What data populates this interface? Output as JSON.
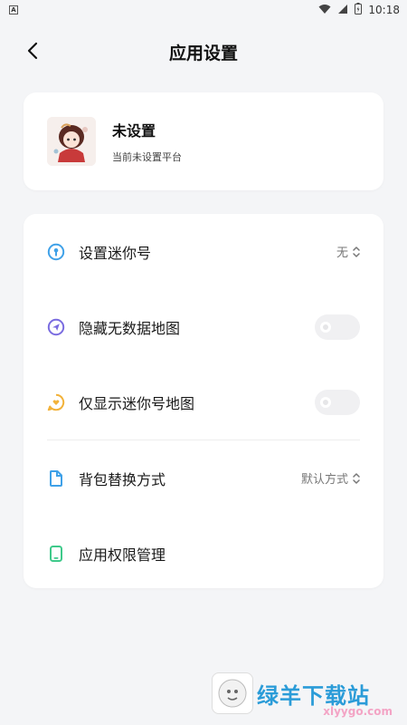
{
  "status_bar": {
    "app_icon": "A",
    "time": "10:18"
  },
  "header": {
    "title": "应用设置"
  },
  "profile": {
    "name": "未设置",
    "description": "当前未设置平台"
  },
  "settings": {
    "items": [
      {
        "icon": "key-icon",
        "label": "设置迷你号",
        "value": "无",
        "control": "select",
        "icon_color": "#3fa1e8"
      },
      {
        "icon": "send-icon",
        "label": "隐藏无数据地图",
        "control": "toggle",
        "on": false,
        "icon_color": "#7a6ce0"
      },
      {
        "icon": "heart-icon",
        "label": "仅显示迷你号地图",
        "control": "toggle",
        "on": false,
        "icon_color": "#f2b23a"
      },
      {
        "icon": "document-icon",
        "label": "背包替换方式",
        "value": "默认方式",
        "control": "select",
        "icon_color": "#3fa1e8"
      },
      {
        "icon": "phone-icon",
        "label": "应用权限管理",
        "control": "none",
        "icon_color": "#3ec98a"
      }
    ]
  },
  "watermark": {
    "text": "绿羊下载站",
    "sub": "xlyygo.com"
  }
}
